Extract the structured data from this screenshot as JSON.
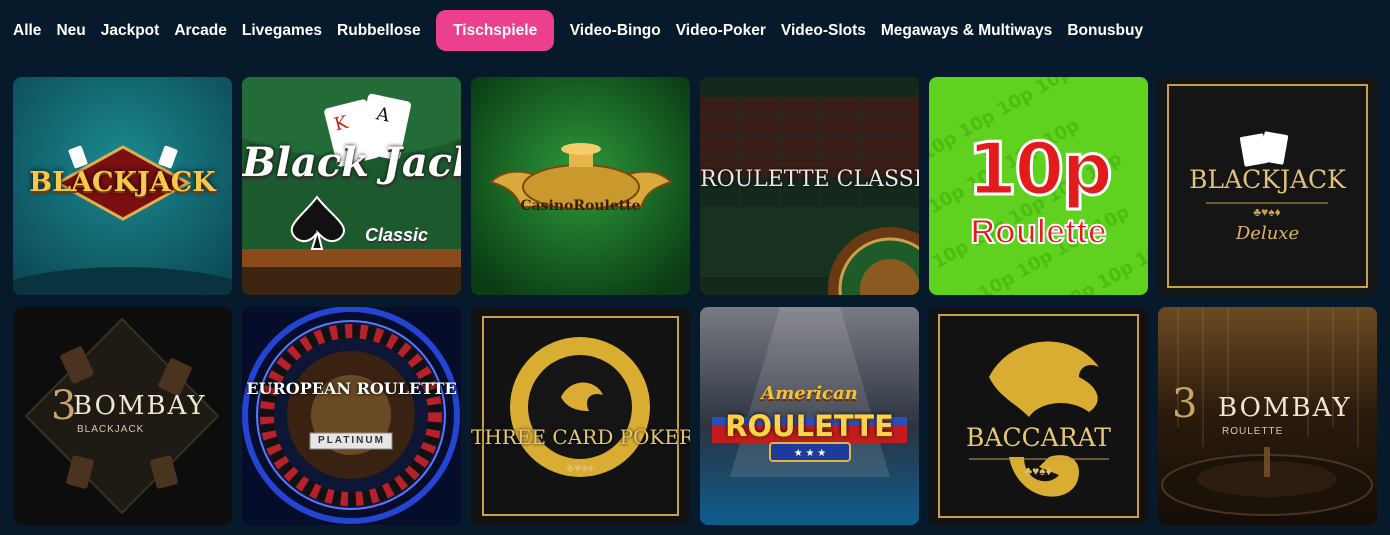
{
  "nav": {
    "tabs": [
      "Alle",
      "Neu",
      "Jackpot",
      "Arcade",
      "Livegames",
      "Rubbellose",
      "Tischspiele",
      "Video-Bingo",
      "Video-Poker",
      "Video-Slots",
      "Megaways & Multiways",
      "Bonusbuy"
    ],
    "active_tab": "Tischspiele"
  },
  "games": [
    {
      "title": "BLACKJACK",
      "subtitle": ""
    },
    {
      "title": "Black Jack",
      "subtitle": "Classic"
    },
    {
      "title": "CasinoRoulette",
      "subtitle": ""
    },
    {
      "title": "ROULETTE CLASSIC",
      "subtitle": ""
    },
    {
      "title": "10p",
      "subtitle": "Roulette"
    },
    {
      "title": "BLACKJACK",
      "subtitle": "Deluxe"
    },
    {
      "title": "BOMBAY",
      "subtitle": "BLACKJACK"
    },
    {
      "title": "EUROPEAN ROULETTE",
      "subtitle": "PLATINUM"
    },
    {
      "title": "THREE CARD POKER",
      "subtitle": ""
    },
    {
      "title": "American",
      "subtitle": "ROULETTE"
    },
    {
      "title": "BACCARAT",
      "subtitle": ""
    },
    {
      "title": "BOMBAY",
      "subtitle": "ROULETTE"
    }
  ],
  "colors": {
    "page_bg": "#071a2b",
    "active_tab": "#ec3f8d",
    "gold": "#d9a93c"
  }
}
